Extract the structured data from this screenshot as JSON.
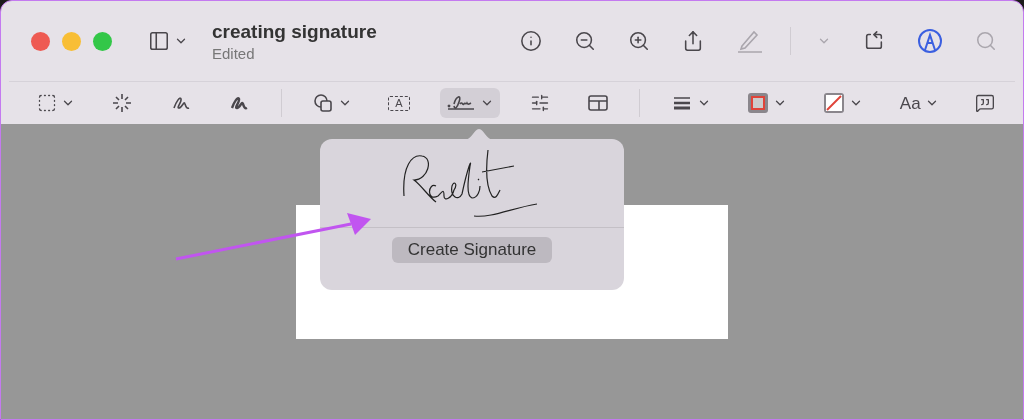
{
  "window": {
    "title": "creating signature",
    "subtitle": "Edited"
  },
  "title_bar_tools": [
    {
      "kind": "info",
      "disabled": false,
      "selected": false
    },
    {
      "kind": "zoom-out",
      "disabled": false,
      "selected": false
    },
    {
      "kind": "zoom-in",
      "disabled": false,
      "selected": false
    },
    {
      "kind": "share",
      "disabled": false,
      "selected": false
    },
    {
      "kind": "highlight",
      "disabled": true,
      "selected": false
    },
    {
      "kind": "highlight-menu",
      "disabled": true,
      "selected": false
    },
    {
      "kind": "rotate",
      "disabled": false,
      "selected": false
    },
    {
      "kind": "markup",
      "disabled": false,
      "selected": true
    },
    {
      "kind": "search",
      "disabled": true,
      "selected": false
    }
  ],
  "markup_tools": [
    {
      "kind": "selection",
      "menu": true,
      "selected": false
    },
    {
      "kind": "instant-alpha",
      "menu": false,
      "selected": false
    },
    {
      "kind": "sketch",
      "menu": false,
      "selected": false
    },
    {
      "kind": "draw",
      "menu": false,
      "selected": false
    },
    {
      "kind": "divider"
    },
    {
      "kind": "shapes",
      "menu": true,
      "selected": false
    },
    {
      "kind": "text",
      "glyph": "A",
      "menu": false,
      "selected": false
    },
    {
      "kind": "sign",
      "menu": true,
      "selected": true
    },
    {
      "kind": "adjust",
      "menu": false,
      "selected": false
    },
    {
      "kind": "page",
      "menu": false,
      "selected": false
    },
    {
      "kind": "divider"
    },
    {
      "kind": "shape-style",
      "menu": true,
      "selected": false
    },
    {
      "kind": "border-color",
      "menu": true,
      "selected": false,
      "color": "#e0443a"
    },
    {
      "kind": "fill-color",
      "menu": true,
      "selected": false,
      "color": "#e0443a"
    },
    {
      "kind": "text-style",
      "glyph": "Aa",
      "menu": true,
      "selected": false
    },
    {
      "kind": "notes",
      "menu": false,
      "selected": false
    }
  ],
  "signature_popover": {
    "button": "Create Signature"
  }
}
